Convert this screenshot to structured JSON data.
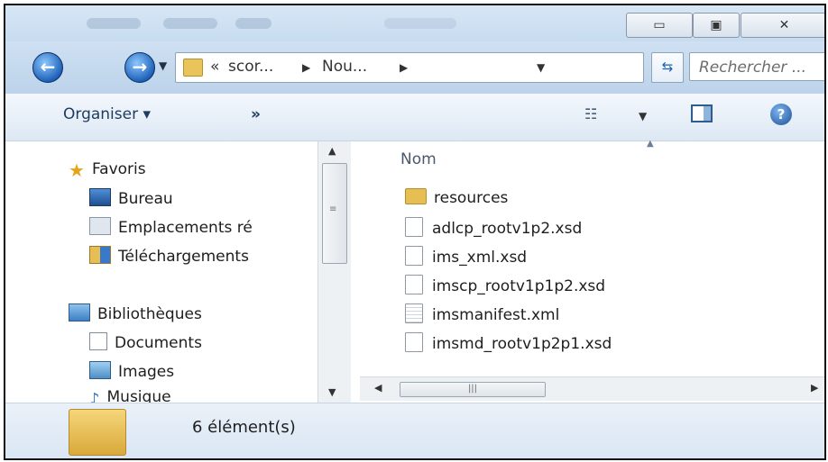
{
  "navbar": {
    "breadcrumb_sep": "«",
    "crumb1": "scor...",
    "crumb2": "Nou...",
    "search_placeholder": "Rechercher ..."
  },
  "toolbar": {
    "organize_label": "Organiser ▾",
    "more_label": "»"
  },
  "navpane": {
    "favorites": "Favoris",
    "items_fav": [
      "Bureau",
      "Emplacements ré",
      "Téléchargements"
    ],
    "libraries": "Bibliothèques",
    "items_lib": [
      "Documents",
      "Images",
      "Musique"
    ]
  },
  "content": {
    "column_name": "Nom",
    "files": [
      {
        "name": "resources",
        "type": "folder"
      },
      {
        "name": "adlcp_rootv1p2.xsd",
        "type": "file"
      },
      {
        "name": "ims_xml.xsd",
        "type": "file"
      },
      {
        "name": "imscp_rootv1p1p2.xsd",
        "type": "file"
      },
      {
        "name": "imsmanifest.xml",
        "type": "file"
      },
      {
        "name": "imsmd_rootv1p2p1.xsd",
        "type": "file"
      }
    ]
  },
  "details": {
    "count": "6 élément(s)"
  },
  "colors": {
    "accent": "#1f62b8",
    "folder": "#e6be51"
  }
}
